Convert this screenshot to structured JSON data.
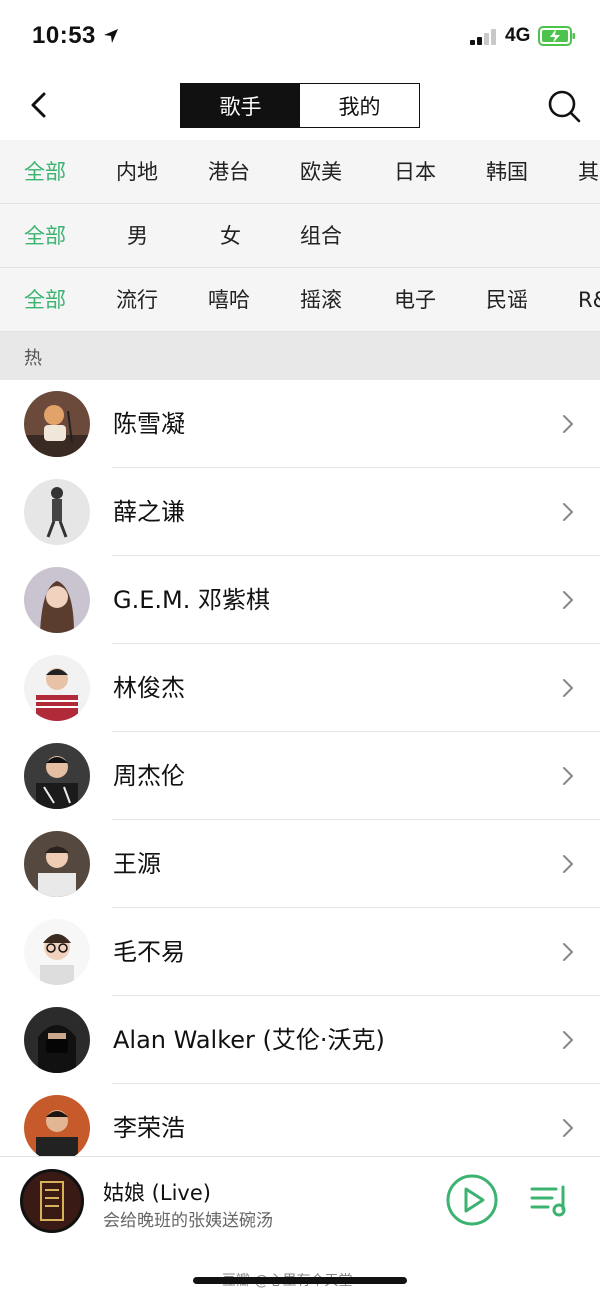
{
  "status_bar": {
    "time": "10:53",
    "network": "4G"
  },
  "nav": {
    "tabs": [
      {
        "label": "歌手",
        "active": true
      },
      {
        "label": "我的",
        "active": false
      }
    ]
  },
  "filters": {
    "region": [
      "全部",
      "内地",
      "港台",
      "欧美",
      "日本",
      "韩国",
      "其"
    ],
    "gender": [
      "全部",
      "男",
      "女",
      "组合"
    ],
    "genre": [
      "全部",
      "流行",
      "嘻哈",
      "摇滚",
      "电子",
      "民谣",
      "R&"
    ]
  },
  "section": {
    "title": "热"
  },
  "artists": [
    {
      "name": "陈雪凝"
    },
    {
      "name": "薛之谦"
    },
    {
      "name": "G.E.M. 邓紫棋"
    },
    {
      "name": "林俊杰"
    },
    {
      "name": "周杰伦"
    },
    {
      "name": "王源"
    },
    {
      "name": "毛不易"
    },
    {
      "name": "Alan Walker (艾伦·沃克)"
    },
    {
      "name": "李荣浩"
    }
  ],
  "player": {
    "song": "姑娘 (Live)",
    "subtitle": "会给晚班的张姨送碗汤"
  },
  "watermark": "豆瓣 @心里有个天堂",
  "colors": {
    "accent": "#3cb371",
    "text": "#111111",
    "filter_bg": "#f5f5f5",
    "section_bg": "#e8e8e8"
  }
}
